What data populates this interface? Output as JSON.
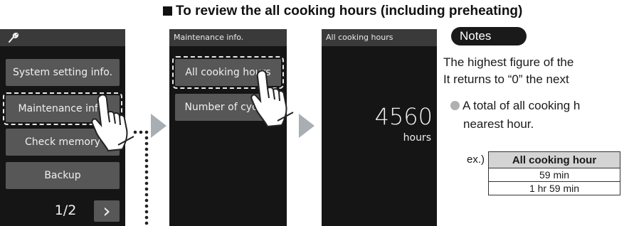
{
  "heading": "To review the all cooking hours (including preheating)",
  "screen1": {
    "items": [
      "System setting info.",
      "Maintenance info.",
      "Check memory",
      "Backup"
    ],
    "page": "1/2",
    "next_glyph": "›"
  },
  "screen2": {
    "title": "Maintenance info.",
    "items": [
      "All cooking hours",
      "Number of cycles"
    ]
  },
  "screen3": {
    "title": "All cooking hours",
    "value": "4560",
    "unit": "hours"
  },
  "notes": {
    "label": "Notes",
    "line1": "The highest figure of the",
    "line2": "It returns to “0” the next",
    "bullet_line1": "A total of all cooking h",
    "bullet_line2": "nearest hour."
  },
  "example": {
    "prefix": "ex.)",
    "header": "All cooking hour",
    "rows": [
      "59 min",
      "1 hr 59 min"
    ]
  },
  "colors": {
    "screen_bg": "#151515",
    "button_bg": "#575757",
    "header_bg": "#3a3a3a",
    "arrow": "#a9aeb3"
  }
}
